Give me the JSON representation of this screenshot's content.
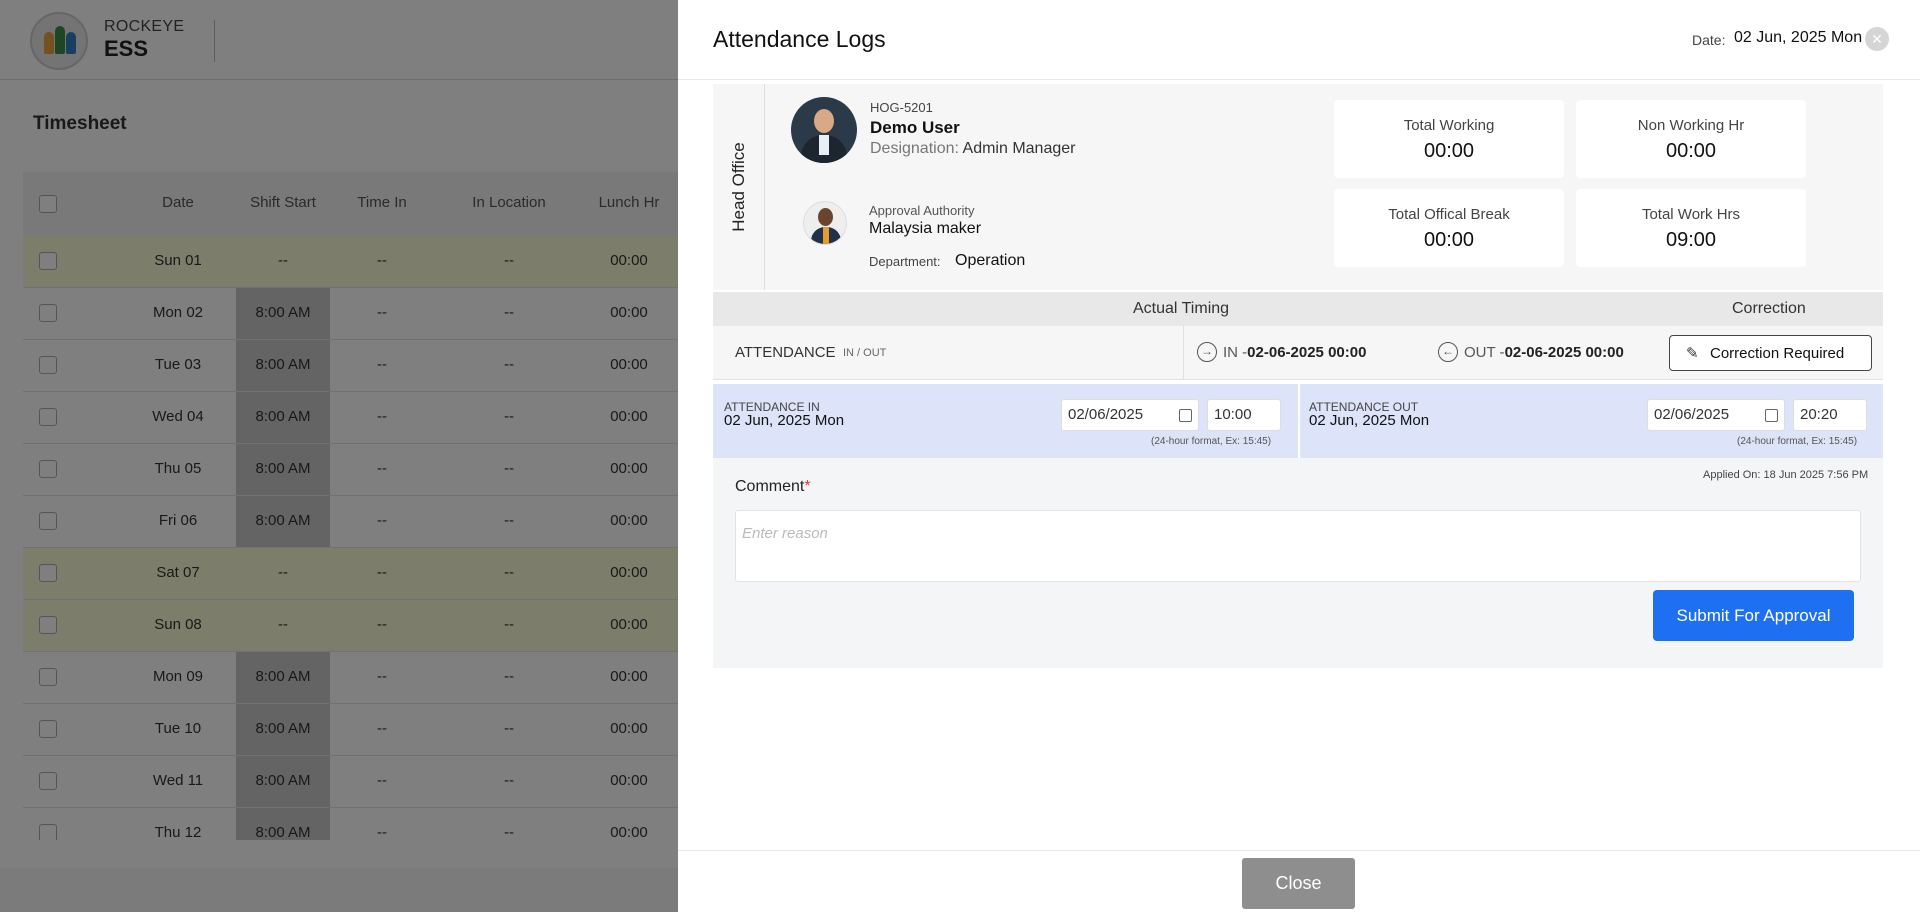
{
  "app": {
    "brand_top": "ROCKEYE",
    "brand_bottom": "ESS",
    "page_title": "Timesheet"
  },
  "timesheet": {
    "columns": [
      "Date",
      "Shift Start",
      "Time In",
      "In Location",
      "Lunch Hr"
    ],
    "rows": [
      {
        "date": "Sun 01",
        "shift": "--",
        "time_in": "--",
        "location": "--",
        "lunch": "00:00",
        "weekend": true
      },
      {
        "date": "Mon 02",
        "shift": "8:00 AM",
        "time_in": "--",
        "location": "--",
        "lunch": "00:00",
        "weekend": false
      },
      {
        "date": "Tue 03",
        "shift": "8:00 AM",
        "time_in": "--",
        "location": "--",
        "lunch": "00:00",
        "weekend": false
      },
      {
        "date": "Wed 04",
        "shift": "8:00 AM",
        "time_in": "--",
        "location": "--",
        "lunch": "00:00",
        "weekend": false
      },
      {
        "date": "Thu 05",
        "shift": "8:00 AM",
        "time_in": "--",
        "location": "--",
        "lunch": "00:00",
        "weekend": false
      },
      {
        "date": "Fri 06",
        "shift": "8:00 AM",
        "time_in": "--",
        "location": "--",
        "lunch": "00:00",
        "weekend": false
      },
      {
        "date": "Sat 07",
        "shift": "--",
        "time_in": "--",
        "location": "--",
        "lunch": "00:00",
        "weekend": true
      },
      {
        "date": "Sun 08",
        "shift": "--",
        "time_in": "--",
        "location": "--",
        "lunch": "00:00",
        "weekend": true
      },
      {
        "date": "Mon 09",
        "shift": "8:00 AM",
        "time_in": "--",
        "location": "--",
        "lunch": "00:00",
        "weekend": false
      },
      {
        "date": "Tue 10",
        "shift": "8:00 AM",
        "time_in": "--",
        "location": "--",
        "lunch": "00:00",
        "weekend": false
      },
      {
        "date": "Wed 11",
        "shift": "8:00 AM",
        "time_in": "--",
        "location": "--",
        "lunch": "00:00",
        "weekend": false
      },
      {
        "date": "Thu 12",
        "shift": "8:00 AM",
        "time_in": "--",
        "location": "--",
        "lunch": "00:00",
        "weekend": false
      }
    ]
  },
  "modal": {
    "title": "Attendance Logs",
    "date_label": "Date:",
    "date_value": "02 Jun, 2025 Mon",
    "close_icon": "close-icon",
    "department_group": "Head Office",
    "employee": {
      "code": "HOG-5201",
      "name": "Demo User",
      "designation_label": "Designation:",
      "designation": "Admin Manager"
    },
    "approval": {
      "label": "Approval Authority",
      "name": "Malaysia maker",
      "department_label": "Department:",
      "department": "Operation"
    },
    "stats": {
      "total_working_label": "Total Working",
      "total_working": "00:00",
      "non_working_label": "Non Working Hr",
      "non_working": "00:00",
      "official_break_label": "Total Offical Break",
      "official_break": "00:00",
      "total_work_hrs_label": "Total Work Hrs",
      "total_work_hrs": "09:00"
    },
    "timing": {
      "actual_label": "Actual Timing",
      "correction_label": "Correction",
      "attendance_label": "ATTENDANCE",
      "attendance_sub": "IN / OUT",
      "in_prefix": "IN -",
      "in_value": "02-06-2025 00:00",
      "out_prefix": "OUT -",
      "out_value": "02-06-2025 00:00",
      "correction_button": "Correction Required"
    },
    "edit": {
      "in_label": "ATTENDANCE IN",
      "in_date_display": "02 Jun, 2025 Mon",
      "in_date_input": "02/06/2025",
      "in_time_input": "10:00",
      "out_label": "ATTENDANCE OUT",
      "out_date_display": "02 Jun, 2025 Mon",
      "out_date_input": "02/06/2025",
      "out_time_input": "20:20",
      "format_hint": "(24-hour format, Ex: 15:45)"
    },
    "comment": {
      "applied_on": "Applied On: 18 Jun 2025 7:56 PM",
      "label": "Comment",
      "required_mark": "*",
      "placeholder": "Enter reason"
    },
    "submit_button": "Submit For Approval",
    "close_button": "Close"
  }
}
